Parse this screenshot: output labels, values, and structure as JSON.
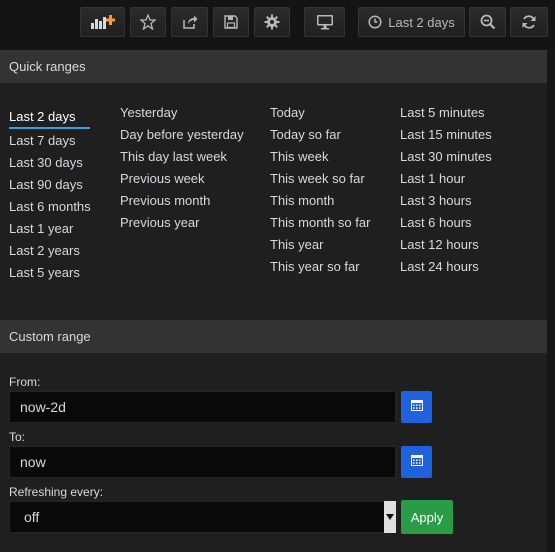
{
  "toolbar": {
    "time_range_label": "Last 2 days",
    "buttons": [
      "add-panel-icon",
      "star-icon",
      "share-icon",
      "save-icon",
      "gear-icon",
      "monitor-icon",
      "clock-icon",
      "zoom-out-icon",
      "refresh-icon"
    ],
    "accent_color": "#ff9830"
  },
  "quick_ranges": {
    "title": "Quick ranges",
    "columns": [
      [
        "Last 2 days",
        "Last 7 days",
        "Last 30 days",
        "Last 90 days",
        "Last 6 months",
        "Last 1 year",
        "Last 2 years",
        "Last 5 years"
      ],
      [
        "Yesterday",
        "Day before yesterday",
        "This day last week",
        "Previous week",
        "Previous month",
        "Previous year"
      ],
      [
        "Today",
        "Today so far",
        "This week",
        "This week so far",
        "This month",
        "This month so far",
        "This year",
        "This year so far"
      ],
      [
        "Last 5 minutes",
        "Last 15 minutes",
        "Last 30 minutes",
        "Last 1 hour",
        "Last 3 hours",
        "Last 6 hours",
        "Last 12 hours",
        "Last 24 hours"
      ]
    ],
    "selected": "Last 2 days"
  },
  "custom_range": {
    "title": "Custom range",
    "from_label": "From:",
    "from_value": "now-2d",
    "to_label": "To:",
    "to_value": "now",
    "refresh_label": "Refreshing every:",
    "refresh_value": "off",
    "apply_label": "Apply"
  },
  "colors": {
    "calendar_button": "#1f62e0",
    "apply_button": "#299c46",
    "active_underline": "#33a2e5"
  }
}
